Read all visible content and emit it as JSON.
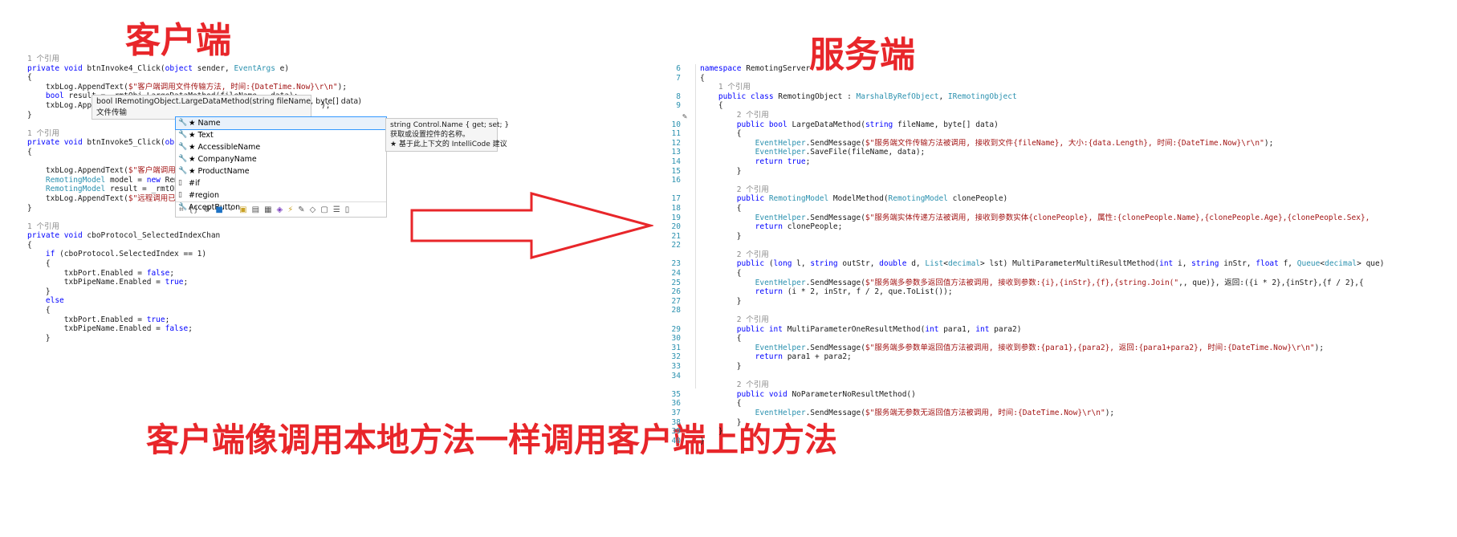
{
  "titles": {
    "client": "客户端",
    "server": "服务端",
    "bottom": "客户端像调用本地方法一样调用客户端上的方法"
  },
  "client_code": [
    {
      "t": "1 个引用",
      "c": "refs"
    },
    {
      "t": "private void btnInvoke4_Click(object sender, EventArgs e)"
    },
    {
      "t": "{"
    },
    {
      "t": "    txbLog.AppendText($\"客户端调用文件传输方法, 时间:{DateTime.Now}\\r\\n\");"
    },
    {
      "t": "    bool result = _rmtObj.LargeDataMethod(fileName, _data);"
    },
    {
      "t": "    txbLog.AppendT                                              \");"
    },
    {
      "t": "}"
    },
    {
      "t": ""
    },
    {
      "t": "1 个引用",
      "c": "refs"
    },
    {
      "t": "private void btnInvoke5_Click(object sende"
    },
    {
      "t": "{"
    },
    {
      "t": ""
    },
    {
      "t": "    txbLog.AppendText($\"客户端调用实体传输"
    },
    {
      "t": "    RemotingModel model = new RemotingMode"
    },
    {
      "t": "    RemotingModel result = _rmtObj.ModelMe"
    },
    {
      "t": "    txbLog.AppendText($\"远程调用已返回, 返"
    },
    {
      "t": "}"
    },
    {
      "t": ""
    },
    {
      "t": "1 个引用",
      "c": "refs"
    },
    {
      "t": "private void cboProtocol_SelectedIndexChan"
    },
    {
      "t": "{"
    },
    {
      "t": "    if (cboProtocol.SelectedIndex == 1)"
    },
    {
      "t": "    {"
    },
    {
      "t": "        txbPort.Enabled = false;"
    },
    {
      "t": "        txbPipeName.Enabled = true;"
    },
    {
      "t": "    }"
    },
    {
      "t": "    else"
    },
    {
      "t": "    {"
    },
    {
      "t": "        txbPort.Enabled = true;"
    },
    {
      "t": "        txbPipeName.Enabled = false;"
    },
    {
      "t": "    }"
    }
  ],
  "signature_tooltip": {
    "signature": "bool IRemotingObject.LargeDataMethod(string fileName, byte[] data)",
    "description": "文件传输"
  },
  "intellisense": {
    "items": [
      {
        "label": "★ Name",
        "icon": "wrench-icon",
        "selected": true
      },
      {
        "label": "★ Text",
        "icon": "wrench-icon"
      },
      {
        "label": "★ AccessibleName",
        "icon": "wrench-icon"
      },
      {
        "label": "★ CompanyName",
        "icon": "wrench-icon"
      },
      {
        "label": "★ ProductName",
        "icon": "wrench-icon"
      },
      {
        "label": "#if",
        "icon": "snippet-icon"
      },
      {
        "label": "#region",
        "icon": "snippet-icon"
      },
      {
        "label": "AcceptButton",
        "icon": "wrench-icon"
      }
    ],
    "description_lines": [
      "string Control.Name { get; set; }",
      "获取或设置控件的名称。",
      "★  基于此上下文的 IntelliCode 建议"
    ]
  },
  "server_line_numbers": [
    "6",
    "7",
    "",
    "8",
    "9",
    "",
    "10",
    "11",
    "12",
    "13",
    "14",
    "15",
    "16",
    "",
    "17",
    "18",
    "19",
    "20",
    "21",
    "22",
    "",
    "23",
    "24",
    "25",
    "26",
    "27",
    "28",
    "",
    "29",
    "30",
    "31",
    "32",
    "33",
    "34",
    "",
    "35",
    "36",
    "37",
    "38",
    "39",
    "40"
  ],
  "server_code": [
    {
      "t": "namespace RemotingServer"
    },
    {
      "t": "{"
    },
    {
      "t": "    1 个引用",
      "c": "refs"
    },
    {
      "t": "    public class RemotingObject : MarshalByRefObject, IRemotingObject"
    },
    {
      "t": "    {"
    },
    {
      "t": "        2 个引用",
      "c": "refs"
    },
    {
      "t": "        public bool LargeDataMethod(string fileName, byte[] data)"
    },
    {
      "t": "        {"
    },
    {
      "t": "            EventHelper.SendMessage($\"服务端文件传输方法被调用, 接收到文件{fileName}, 大小:{data.Length}, 时间:{DateTime.Now}\\r\\n\");"
    },
    {
      "t": "            EventHelper.SaveFile(fileName, data);"
    },
    {
      "t": "            return true;"
    },
    {
      "t": "        }"
    },
    {
      "t": ""
    },
    {
      "t": "        2 个引用",
      "c": "refs"
    },
    {
      "t": "        public RemotingModel ModelMethod(RemotingModel clonePeople)"
    },
    {
      "t": "        {"
    },
    {
      "t": "            EventHelper.SendMessage($\"服务端实体传递方法被调用, 接收到参数实体{clonePeople}, 属性:{clonePeople.Name},{clonePeople.Age},{clonePeople.Sex},"
    },
    {
      "t": "            return clonePeople;"
    },
    {
      "t": "        }"
    },
    {
      "t": ""
    },
    {
      "t": "        2 个引用",
      "c": "refs"
    },
    {
      "t": "        public (long l, string outStr, double d, List<decimal> lst) MultiParameterMultiResultMethod(int i, string inStr, float f, Queue<decimal> que)"
    },
    {
      "t": "        {"
    },
    {
      "t": "            EventHelper.SendMessage($\"服务端多参数多返回值方法被调用, 接收到参数:{i},{inStr},{f},{string.Join(\",\", que)}, 返回:({i * 2},{inStr},{f / 2},{"
    },
    {
      "t": "            return (i * 2, inStr, f / 2, que.ToList());"
    },
    {
      "t": "        }"
    },
    {
      "t": ""
    },
    {
      "t": "        2 个引用",
      "c": "refs"
    },
    {
      "t": "        public int MultiParameterOneResultMethod(int para1, int para2)"
    },
    {
      "t": "        {"
    },
    {
      "t": "            EventHelper.SendMessage($\"服务端多参数单返回值方法被调用, 接收到参数:{para1},{para2}, 返回:{para1+para2}, 时间:{DateTime.Now}\\r\\n\");"
    },
    {
      "t": "            return para1 + para2;"
    },
    {
      "t": "        }"
    },
    {
      "t": ""
    },
    {
      "t": "        2 个引用",
      "c": "refs"
    },
    {
      "t": "        public void NoParameterNoResultMethod()"
    },
    {
      "t": "        {"
    },
    {
      "t": "            EventHelper.SendMessage($\"服务端无参数无返回值方法被调用, 时间:{DateTime.Now}\\r\\n\");"
    },
    {
      "t": "        }"
    },
    {
      "t": "    }"
    },
    {
      "t": "}"
    }
  ],
  "colors": {
    "title_red": "#e8262a",
    "keyword": "#0000ff",
    "type": "#2b91af",
    "string": "#a31515"
  }
}
